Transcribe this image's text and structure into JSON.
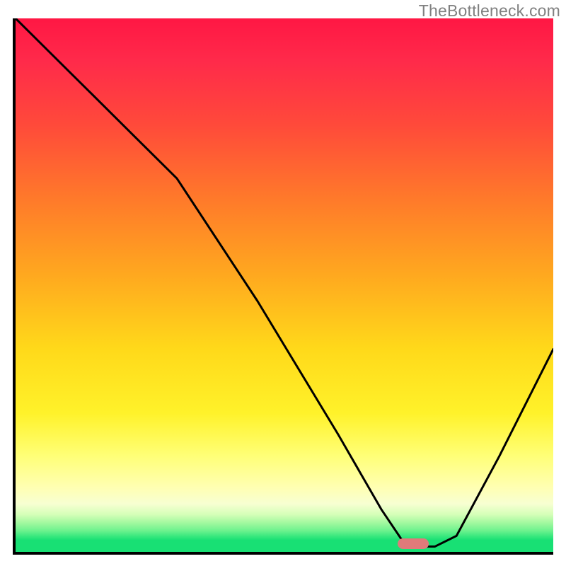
{
  "watermark": "TheBottleneck.com",
  "chart_data": {
    "type": "line",
    "title": "",
    "xlabel": "",
    "ylabel": "",
    "xlim": [
      0,
      100
    ],
    "ylim": [
      0,
      100
    ],
    "series": [
      {
        "name": "bottleneck-curve",
        "x": [
          0,
          10,
          22,
          30,
          45,
          60,
          68,
          72,
          76,
          78,
          82,
          90,
          100
        ],
        "y": [
          100,
          90,
          78,
          70,
          47,
          22,
          8,
          2,
          1,
          1,
          3,
          18,
          38
        ]
      }
    ],
    "marker": {
      "x": 74,
      "y": 1.5,
      "color": "#e07a7a"
    },
    "gradient_stops": [
      {
        "pos": 0,
        "color": "#ff1744"
      },
      {
        "pos": 0.34,
        "color": "#ff7a2a"
      },
      {
        "pos": 0.62,
        "color": "#ffd91a"
      },
      {
        "pos": 0.88,
        "color": "#ffffb3"
      },
      {
        "pos": 0.97,
        "color": "#18e074"
      }
    ]
  }
}
